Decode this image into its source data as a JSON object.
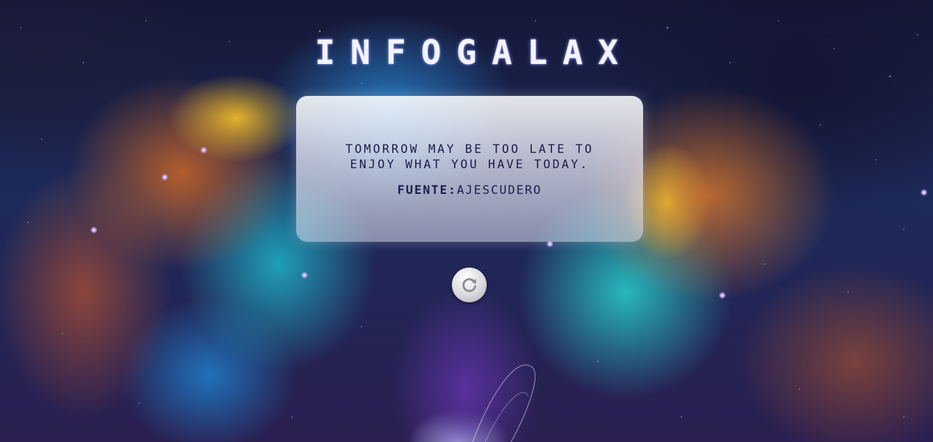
{
  "app": {
    "title": "INFOGALAX"
  },
  "card": {
    "quote": "TOMORROW MAY BE TOO LATE TO ENJOY WHAT YOU HAVE TODAY.",
    "source_label": "FUENTE:",
    "source_name": "AJESCUDERO"
  },
  "controls": {
    "refresh_icon": "refresh-icon"
  },
  "colors": {
    "title_text": "#f3f4ff",
    "card_text": "#1c1d4a",
    "card_background": "#f4f4fa"
  }
}
